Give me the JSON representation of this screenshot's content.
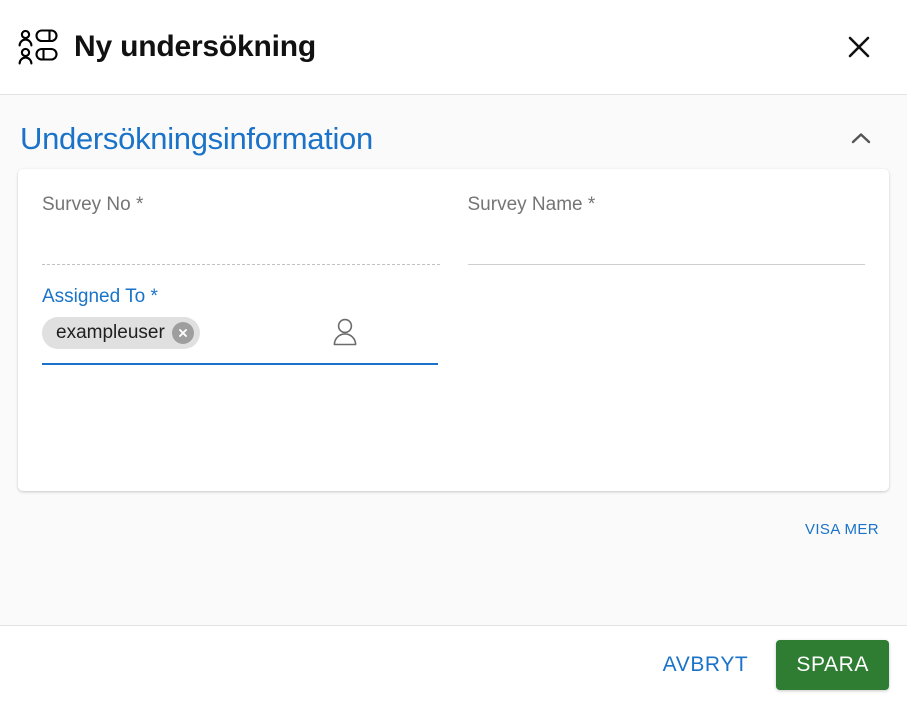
{
  "header": {
    "icon": "poll-survey-icon",
    "title": "Ny undersökning",
    "close_icon": "close-icon"
  },
  "section": {
    "title": "Undersökningsinformation",
    "collapse_icon": "chevron-up-icon",
    "expanded": true
  },
  "form": {
    "fields": [
      {
        "label": "Survey No *",
        "value": "",
        "placeholder": "",
        "state": "disabled",
        "underline": "dotted"
      },
      {
        "label": "Survey Name *",
        "value": "",
        "placeholder": "",
        "state": "enabled",
        "underline": "solid"
      }
    ],
    "assigned_to": {
      "label": "Assigned To *",
      "state": "focused",
      "underline": "focused",
      "person_icon": "person-icon",
      "chips": [
        {
          "label": "exampleuser",
          "remove_icon": "chip-remove-icon"
        }
      ]
    }
  },
  "show_more": {
    "label": "VISA MER"
  },
  "footer": {
    "cancel_label": "AVBRYT",
    "save_label": "SPARA"
  },
  "colors": {
    "accent_blue": "#1a73c8",
    "save_green": "#2e7d32",
    "label_gray": "#757575",
    "body_background": "#fafafa",
    "chip_background": "#e0e0e0"
  }
}
